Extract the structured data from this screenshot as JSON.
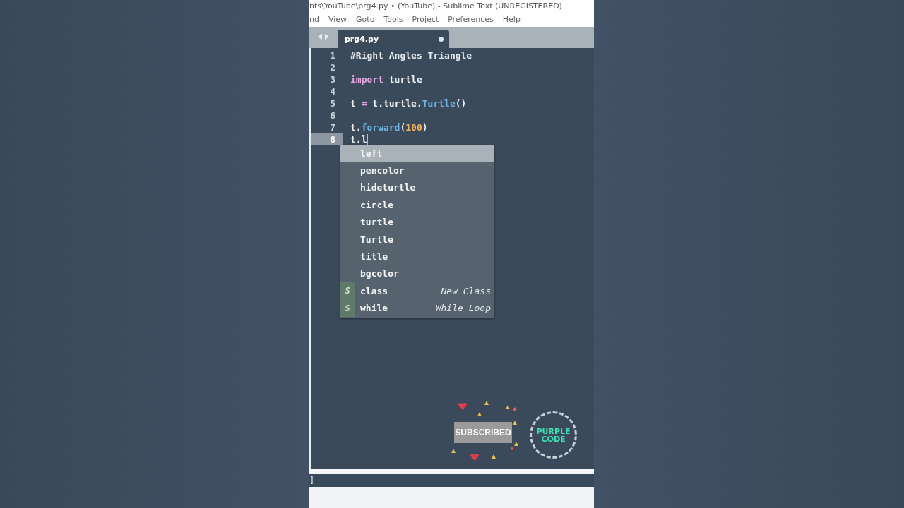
{
  "window": {
    "title": "nts\\YouTube\\prg4.py • (YouTube) - Sublime Text (UNREGISTERED)"
  },
  "menu": [
    "nd",
    "View",
    "Goto",
    "Tools",
    "Project",
    "Preferences",
    "Help"
  ],
  "tabs": [
    {
      "label": "prg4.py",
      "selected": true,
      "modified": true
    }
  ],
  "editor": {
    "lines": [
      {
        "number": "1",
        "current": false,
        "cursor": false,
        "tokens": [
          {
            "kind": "comment",
            "text": "#Right Angles Triangle"
          }
        ]
      },
      {
        "number": "2",
        "current": false,
        "cursor": false
      },
      {
        "number": "3",
        "current": false,
        "cursor": false,
        "tokens": [
          {
            "kind": "keyword",
            "text": "import"
          },
          {
            "kind": "plain",
            "text": " turtle"
          }
        ]
      },
      {
        "number": "4",
        "current": false,
        "cursor": false
      },
      {
        "number": "5",
        "current": false,
        "cursor": false,
        "tokens": [
          {
            "kind": "plain",
            "text": "t "
          },
          {
            "kind": "keyword",
            "text": "="
          },
          {
            "kind": "plain",
            "text": " t.turtle."
          },
          {
            "kind": "function",
            "text": "Turtle"
          },
          {
            "kind": "plain",
            "text": "()"
          }
        ]
      },
      {
        "number": "6",
        "current": false,
        "cursor": false
      },
      {
        "number": "7",
        "current": false,
        "cursor": false,
        "tokens": [
          {
            "kind": "plain",
            "text": "t."
          },
          {
            "kind": "function",
            "text": "forward"
          },
          {
            "kind": "plain",
            "text": "("
          },
          {
            "kind": "number",
            "text": "100"
          },
          {
            "kind": "plain",
            "text": ")"
          }
        ]
      },
      {
        "number": "8",
        "current": true,
        "cursor": true,
        "tokens": [
          {
            "kind": "plain",
            "text": "t.l"
          }
        ]
      }
    ]
  },
  "completions": [
    {
      "kind": "word",
      "label": "left",
      "selected": true
    },
    {
      "kind": "word",
      "label": "pencolor",
      "selected": false
    },
    {
      "kind": "word",
      "label": "hideturtle",
      "selected": false
    },
    {
      "kind": "word",
      "label": "circle",
      "selected": false
    },
    {
      "kind": "word",
      "label": "turtle",
      "selected": false
    },
    {
      "kind": "word",
      "label": "Turtle",
      "selected": false
    },
    {
      "kind": "word",
      "label": "title",
      "selected": false
    },
    {
      "kind": "word",
      "label": "bgcolor",
      "selected": false
    },
    {
      "kind": "snippet",
      "badge": "S",
      "label": "class",
      "hint": "New Class",
      "selected": false
    },
    {
      "kind": "snippet",
      "badge": "S",
      "label": "while",
      "hint": "While Loop",
      "selected": false
    }
  ],
  "overlay": {
    "subscribe_button": "SUBSCRIBED",
    "logo": [
      "PURPLE",
      "CODE"
    ]
  },
  "console": {
    "text": "]"
  }
}
